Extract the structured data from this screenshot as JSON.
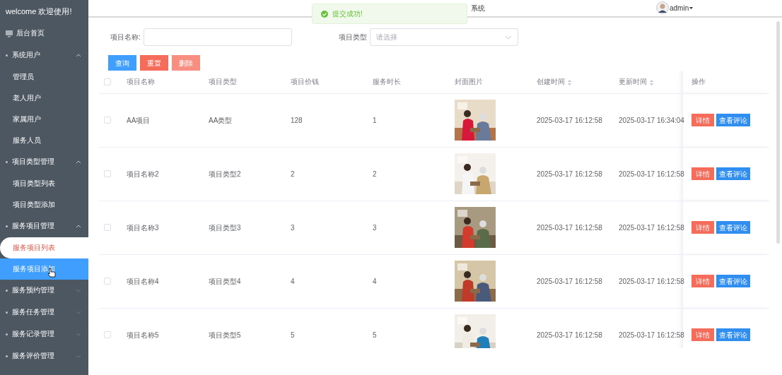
{
  "sidebar": {
    "welcome": "welcome 欢迎使用!",
    "home": "后台首页",
    "groups": [
      {
        "label": "系统用户",
        "expanded": true,
        "children": [
          {
            "label": "管理员",
            "selected": false,
            "hovered": false
          },
          {
            "label": "老人用户",
            "selected": false,
            "hovered": false
          },
          {
            "label": "家属用户",
            "selected": false,
            "hovered": false
          },
          {
            "label": "服务人员",
            "selected": false,
            "hovered": false
          }
        ]
      },
      {
        "label": "项目类型管理",
        "expanded": true,
        "children": [
          {
            "label": "项目类型列表",
            "selected": false,
            "hovered": false
          },
          {
            "label": "项目类型添加",
            "selected": false,
            "hovered": false
          }
        ]
      },
      {
        "label": "服务项目管理",
        "expanded": true,
        "children": [
          {
            "label": "服务项目列表",
            "selected": true,
            "hovered": false
          },
          {
            "label": "服务项目添加",
            "selected": false,
            "hovered": true
          }
        ]
      },
      {
        "label": "服务预约管理",
        "expanded": false
      },
      {
        "label": "服务任务管理",
        "expanded": false
      },
      {
        "label": "服务记录管理",
        "expanded": false
      },
      {
        "label": "服务评价管理",
        "expanded": false
      }
    ]
  },
  "header": {
    "title_visible_part": "系统",
    "user": "admin"
  },
  "toast": {
    "message": "提交成功!"
  },
  "filters": [
    {
      "label": "项目名称:",
      "kind": "text"
    },
    {
      "label": "项目类型",
      "kind": "select",
      "placeholder": "请选择"
    }
  ],
  "buttons": [
    {
      "label": "查询",
      "kind": "primary"
    },
    {
      "label": "重置",
      "kind": "danger"
    },
    {
      "label": "删除",
      "kind": "danger-light"
    }
  ],
  "table": {
    "all_checked": false,
    "columns": [
      {
        "label": "项目名称",
        "sortable": false
      },
      {
        "label": "项目类型",
        "sortable": false
      },
      {
        "label": "项目价钱",
        "sortable": false
      },
      {
        "label": "服务时长",
        "sortable": false
      },
      {
        "label": "封面图片",
        "sortable": false
      },
      {
        "label": "创建时间",
        "sortable": true
      },
      {
        "label": "更新时间",
        "sortable": true
      },
      {
        "label": "操作",
        "sortable": false
      }
    ],
    "rows": [
      {
        "checked": false,
        "cells": [
          "AA项目",
          "AA类型",
          "128",
          "1"
        ],
        "picture": {
          "kind": "picture"
        },
        "created": "2025-03-17 16:12:58",
        "updated": "2025-03-17 16:34:04",
        "actions": [
          "详情",
          "查看评论"
        ]
      },
      {
        "checked": false,
        "cells": [
          "项目名称2",
          "项目类型2",
          "2",
          "2"
        ],
        "picture": {
          "kind": "picture"
        },
        "created": "2025-03-17 16:12:58",
        "updated": "2025-03-17 16:12:58",
        "actions": [
          "详情",
          "查看评论"
        ]
      },
      {
        "checked": false,
        "cells": [
          "项目名称3",
          "项目类型3",
          "3",
          "3"
        ],
        "picture": {
          "kind": "picture"
        },
        "created": "2025-03-17 16:12:58",
        "updated": "2025-03-17 16:12:58",
        "actions": [
          "详情",
          "查看评论"
        ]
      },
      {
        "checked": false,
        "cells": [
          "项目名称4",
          "项目类型4",
          "4",
          "4"
        ],
        "picture": {
          "kind": "picture"
        },
        "created": "2025-03-17 16:12:58",
        "updated": "2025-03-17 16:12:58",
        "actions": [
          "详情",
          "查看评论"
        ]
      },
      {
        "checked": false,
        "cells": [
          "项目名称5",
          "项目类型5",
          "5",
          "5"
        ],
        "picture": {
          "kind": "picture"
        },
        "created": "2025-03-17 16:12:58",
        "updated": "2025-03-17 16:12:58",
        "actions": [
          "详情",
          "查看评论"
        ]
      }
    ]
  }
}
